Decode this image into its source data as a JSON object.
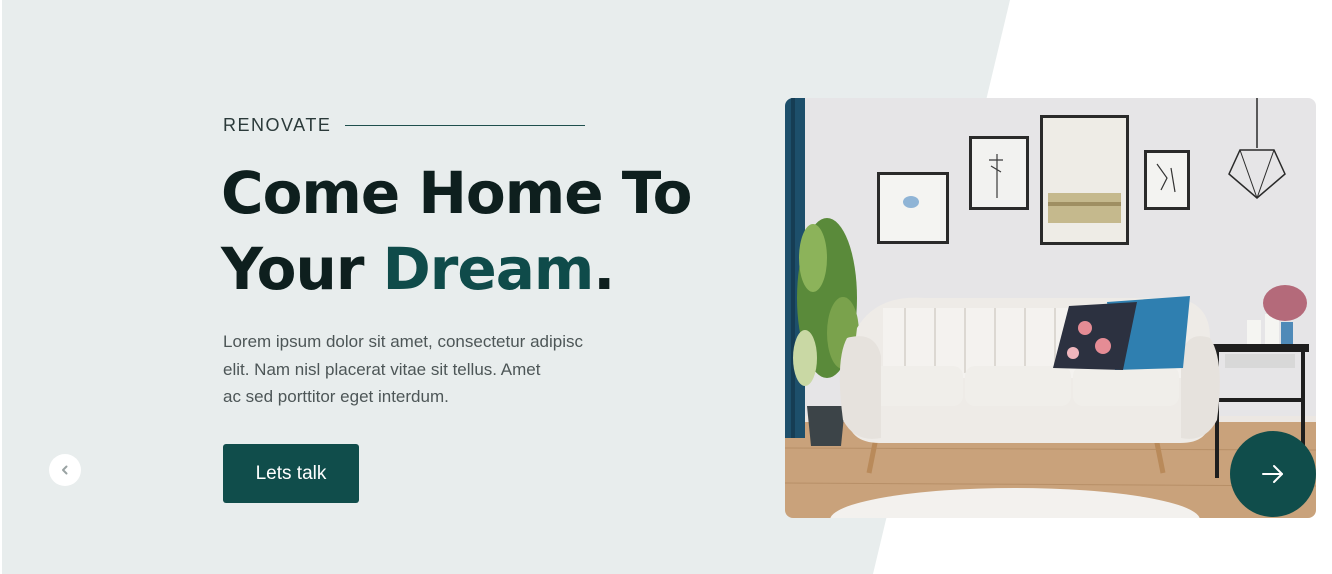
{
  "hero": {
    "eyebrow": "RENOVATE",
    "headline_line1": "Come Home To",
    "headline_line2_prefix": "Your ",
    "headline_accent": "Dream",
    "headline_suffix": ".",
    "description_lines": [
      "Lorem ipsum dolor sit amet, consectetur adipisc",
      "elit. Nam nisl placerat vitae sit tellus. Amet",
      "ac sed porttitor eget interdum."
    ],
    "cta_label": "Lets talk"
  },
  "carousel": {
    "prev_icon": "chevron-left-icon",
    "next_icon": "arrow-right-icon"
  },
  "colors": {
    "panel_bg": "#e8eded",
    "brand": "#104d4b",
    "heading": "#0e1f1e",
    "accent_text": "#0f4b4a",
    "body_text": "#4d5657"
  }
}
